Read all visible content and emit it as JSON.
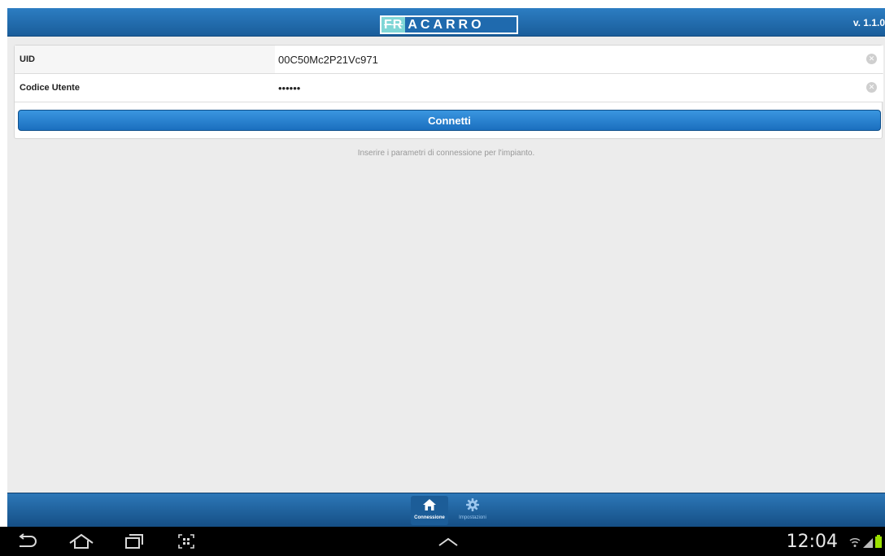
{
  "header": {
    "logo_fr": "FR",
    "logo_rest": "ACARRO",
    "version": "v. 1.1.0"
  },
  "form": {
    "fields": [
      {
        "label": "UID",
        "value": "00C50Mc2P21Vc971"
      },
      {
        "label": "Codice Utente",
        "value": "••••••"
      }
    ],
    "connect_label": "Connetti"
  },
  "hint": "Inserire i parametri di connessione per l'impianto.",
  "tabs": [
    {
      "label": "Connessione",
      "icon": "home-icon",
      "active": true
    },
    {
      "label": "Impostazioni",
      "icon": "gear-icon",
      "active": false
    }
  ],
  "system": {
    "clock": "12:04"
  },
  "colors": {
    "accent": "#1f6aae",
    "logo_accent": "#7fd6d6",
    "battery": "#9be000"
  }
}
